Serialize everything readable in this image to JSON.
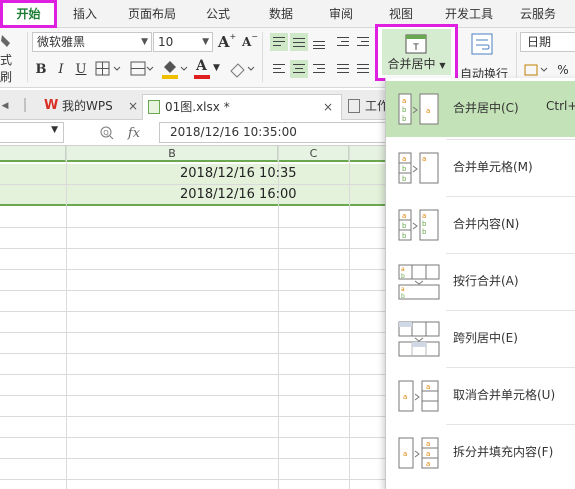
{
  "menu": {
    "tabs": [
      {
        "label": "开始",
        "active": true
      },
      {
        "label": "插入"
      },
      {
        "label": "页面布局"
      },
      {
        "label": "公式"
      },
      {
        "label": "数据"
      },
      {
        "label": "审阅"
      },
      {
        "label": "视图"
      },
      {
        "label": "开发工具"
      },
      {
        "label": "云服务"
      }
    ]
  },
  "ribbon": {
    "font_name": "微软雅黑",
    "font_size": "10",
    "grow_label": "A",
    "shrink_label": "A",
    "format_painter_label": "式刷",
    "bold": "B",
    "italic": "I",
    "underline": "U",
    "font_color_label": "A",
    "merge_center_label": "合并居中",
    "wrap_text_label": "自动换行",
    "number_format": "日期",
    "percent": "%",
    "accent_color": "#6aa84f",
    "highlight_color": "#e020e0",
    "font_color": "#e02020",
    "fill_color": "#f0c000"
  },
  "doctabs": {
    "items": [
      {
        "label": "我的WPS"
      },
      {
        "label": "01图.xlsx *",
        "active": true
      },
      {
        "label": "工作"
      }
    ]
  },
  "formula_bar": {
    "fx_label": "fx",
    "value": "2018/12/16  10:35:00"
  },
  "grid": {
    "columns": [
      "B",
      "C"
    ],
    "cells": [
      {
        "text": "2018/12/16 10:35"
      },
      {
        "text": "2018/12/16 16:00"
      }
    ]
  },
  "merge_menu": {
    "items": [
      {
        "label": "合并居中(C)",
        "shortcut": "Ctrl+",
        "highlighted": true
      },
      {
        "label": "合并单元格(M)"
      },
      {
        "label": "合并内容(N)"
      },
      {
        "label": "按行合并(A)"
      },
      {
        "label": "跨列居中(E)"
      },
      {
        "label": "取消合并单元格(U)"
      },
      {
        "label": "拆分并填充内容(F)"
      }
    ]
  }
}
